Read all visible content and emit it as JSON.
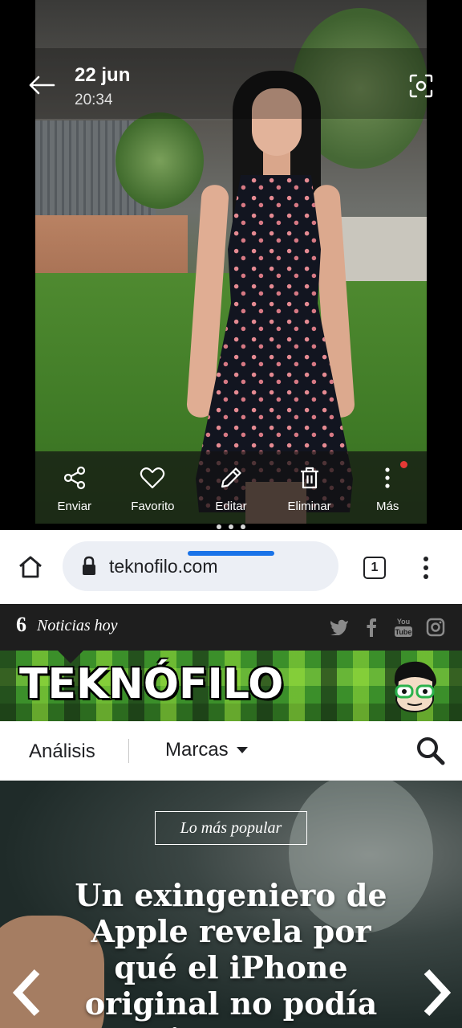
{
  "gallery": {
    "date": "22 jun",
    "time": "20:34",
    "actions": [
      {
        "label": "Enviar",
        "icon": "share-icon"
      },
      {
        "label": "Favorito",
        "icon": "heart-icon"
      },
      {
        "label": "Editar",
        "icon": "pencil-icon"
      },
      {
        "label": "Eliminar",
        "icon": "trash-icon"
      },
      {
        "label": "Más",
        "icon": "more-vertical-icon"
      }
    ]
  },
  "browser": {
    "url": "teknofilo.com",
    "tab_count": "1",
    "news": {
      "count": "6",
      "label": "Noticias hoy"
    },
    "site_name": "TEKNÓFILO",
    "nav": {
      "analisis": "Análisis",
      "marcas": "Marcas"
    },
    "hero": {
      "tag": "Lo más popular",
      "headline": "Un exingeniero de Apple revela por qué el iPhone original no podía copiar y pegar"
    }
  },
  "colors": {
    "accent_blue": "#1a73e8",
    "notification_dot": "#e53935",
    "banner_green": "#3b8f2a"
  }
}
